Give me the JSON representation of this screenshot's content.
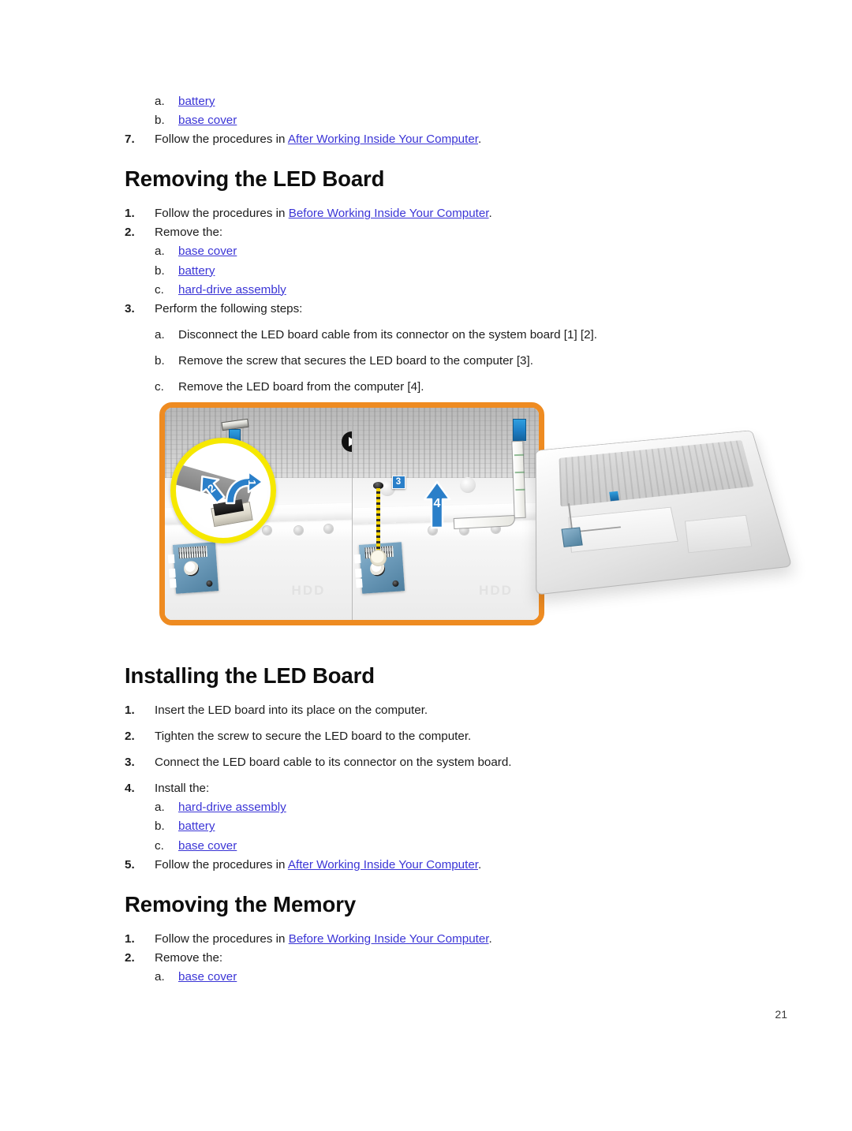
{
  "document": {
    "page_number": "21",
    "link_color": "#3b35d6",
    "accent_orange": "#ee8b21",
    "accent_yellow": "#f6e800",
    "accent_blue": "#2a7fc9"
  },
  "blocks": [
    {
      "kind": "step",
      "level": 2,
      "marker": "a.",
      "segments": [
        {
          "type": "link",
          "text": "battery"
        }
      ]
    },
    {
      "kind": "step",
      "level": 2,
      "marker": "b.",
      "segments": [
        {
          "type": "link",
          "text": "base cover"
        }
      ]
    },
    {
      "kind": "step",
      "level": 1,
      "marker": "7.",
      "segments": [
        {
          "type": "text",
          "text": "Follow the procedures in "
        },
        {
          "type": "link",
          "text": "After Working Inside Your Computer"
        },
        {
          "type": "text",
          "text": "."
        }
      ]
    },
    {
      "kind": "spacer",
      "size": "a"
    },
    {
      "kind": "heading",
      "text": "Removing the LED Board"
    },
    {
      "kind": "spacer",
      "size": "b"
    },
    {
      "kind": "step",
      "level": 1,
      "marker": "1.",
      "segments": [
        {
          "type": "text",
          "text": "Follow the procedures in "
        },
        {
          "type": "link",
          "text": "Before Working Inside Your Computer"
        },
        {
          "type": "text",
          "text": "."
        }
      ]
    },
    {
      "kind": "step",
      "level": 1,
      "marker": "2.",
      "segments": [
        {
          "type": "text",
          "text": "Remove the:"
        }
      ]
    },
    {
      "kind": "step",
      "level": 2,
      "marker": "a.",
      "segments": [
        {
          "type": "link",
          "text": "base cover"
        }
      ]
    },
    {
      "kind": "step",
      "level": 2,
      "marker": "b.",
      "segments": [
        {
          "type": "link",
          "text": "battery"
        }
      ]
    },
    {
      "kind": "step",
      "level": 2,
      "marker": "c.",
      "segments": [
        {
          "type": "link",
          "text": "hard-drive assembly"
        }
      ]
    },
    {
      "kind": "step",
      "level": 1,
      "marker": "3.",
      "segments": [
        {
          "type": "text",
          "text": "Perform the following steps:"
        }
      ]
    },
    {
      "kind": "spacer",
      "size": "d"
    },
    {
      "kind": "step",
      "level": 2,
      "marker": "a.",
      "segments": [
        {
          "type": "text",
          "text": "Disconnect the LED board cable from its connector on the system board [1] [2]."
        }
      ]
    },
    {
      "kind": "spacer",
      "size": "d"
    },
    {
      "kind": "step",
      "level": 2,
      "marker": "b.",
      "segments": [
        {
          "type": "text",
          "text": "Remove the screw that secures the LED board to the computer [3]."
        }
      ]
    },
    {
      "kind": "spacer",
      "size": "d"
    },
    {
      "kind": "step",
      "level": 2,
      "marker": "c.",
      "segments": [
        {
          "type": "text",
          "text": "Remove the LED board from the computer [4]."
        }
      ]
    }
  ],
  "blocks_after_figure": [
    {
      "kind": "heading",
      "text": "Installing the LED Board"
    },
    {
      "kind": "spacer",
      "size": "b"
    },
    {
      "kind": "step",
      "level": 1,
      "marker": "1.",
      "segments": [
        {
          "type": "text",
          "text": "Insert the LED board into its place on the computer."
        }
      ]
    },
    {
      "kind": "spacer",
      "size": "d"
    },
    {
      "kind": "step",
      "level": 1,
      "marker": "2.",
      "segments": [
        {
          "type": "text",
          "text": "Tighten the screw to secure the LED board to the computer."
        }
      ]
    },
    {
      "kind": "spacer",
      "size": "d"
    },
    {
      "kind": "step",
      "level": 1,
      "marker": "3.",
      "segments": [
        {
          "type": "text",
          "text": "Connect the LED board cable to its connector on the system board."
        }
      ]
    },
    {
      "kind": "spacer",
      "size": "d"
    },
    {
      "kind": "step",
      "level": 1,
      "marker": "4.",
      "segments": [
        {
          "type": "text",
          "text": "Install the:"
        }
      ]
    },
    {
      "kind": "step",
      "level": 2,
      "marker": "a.",
      "segments": [
        {
          "type": "link",
          "text": "hard-drive assembly"
        }
      ]
    },
    {
      "kind": "step",
      "level": 2,
      "marker": "b.",
      "segments": [
        {
          "type": "link",
          "text": "battery"
        }
      ]
    },
    {
      "kind": "step",
      "level": 2,
      "marker": "c.",
      "segments": [
        {
          "type": "link",
          "text": "base cover"
        }
      ]
    },
    {
      "kind": "step",
      "level": 1,
      "marker": "5.",
      "segments": [
        {
          "type": "text",
          "text": "Follow the procedures in "
        },
        {
          "type": "link",
          "text": "After Working Inside Your Computer"
        },
        {
          "type": "text",
          "text": "."
        }
      ]
    },
    {
      "kind": "spacer",
      "size": "a"
    },
    {
      "kind": "heading",
      "text": "Removing the Memory"
    },
    {
      "kind": "spacer",
      "size": "b"
    },
    {
      "kind": "step",
      "level": 1,
      "marker": "1.",
      "segments": [
        {
          "type": "text",
          "text": "Follow the procedures in "
        },
        {
          "type": "link",
          "text": "Before Working Inside Your Computer"
        },
        {
          "type": "text",
          "text": "."
        }
      ]
    },
    {
      "kind": "step",
      "level": 1,
      "marker": "2.",
      "segments": [
        {
          "type": "text",
          "text": "Remove the:"
        }
      ]
    },
    {
      "kind": "step",
      "level": 2,
      "marker": "a.",
      "segments": [
        {
          "type": "link",
          "text": "base cover"
        }
      ]
    }
  ],
  "figure": {
    "caption_labels": {
      "callout_1": "1",
      "callout_2": "2",
      "callout_3": "3",
      "callout_4": "4"
    },
    "hdd_marking": "HDD",
    "panels": [
      {
        "name": "before",
        "description": "LED board cable connected to the system board with a magnified inset showing the latch being lifted"
      },
      {
        "name": "after",
        "description": "Screw removed and LED board lifted out of the computer"
      }
    ]
  }
}
